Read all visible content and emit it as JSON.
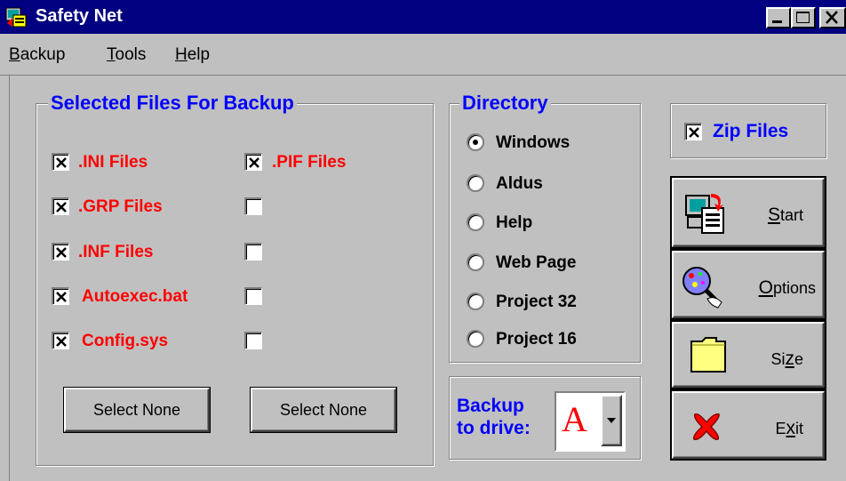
{
  "window": {
    "title": "Safety Net"
  },
  "menu": [
    {
      "label": "Backup",
      "mnemonic": "B",
      "rest": "ackup"
    },
    {
      "label": "Tools",
      "mnemonic": "T",
      "rest": "ools"
    },
    {
      "label": "Help",
      "mnemonic": "H",
      "rest": "elp"
    }
  ],
  "files_group": {
    "title": "Selected Files For Backup",
    "left_column": [
      {
        "label": ".INI Files",
        "checked": true
      },
      {
        "label": ".GRP Files",
        "checked": true
      },
      {
        "label": ".INF Files",
        "checked": true
      },
      {
        "label": "Autoexec.bat",
        "checked": true
      },
      {
        "label": "Config.sys",
        "checked": true
      }
    ],
    "right_column": [
      {
        "label": ".PIF Files",
        "checked": true
      },
      {
        "label": "",
        "checked": false
      },
      {
        "label": "",
        "checked": false
      },
      {
        "label": "",
        "checked": false
      },
      {
        "label": "",
        "checked": false
      }
    ],
    "select_none_left": "Select None",
    "select_none_right": "Select None"
  },
  "directory_group": {
    "title": "Directory",
    "options": [
      "Windows",
      "Aldus",
      "Help",
      "Web Page",
      "Project 32",
      "Project 16"
    ],
    "selected": "Windows"
  },
  "zip": {
    "label": "Zip Files",
    "checked": true
  },
  "actions": {
    "start": {
      "label": "Start",
      "mnemonic": "S",
      "rest": "tart"
    },
    "options": {
      "label": "Options",
      "mnemonic": "O",
      "rest": "ptions"
    },
    "size": {
      "label": "Size",
      "pre": "Si",
      "mnemonic": "z",
      "post": "e"
    },
    "exit": {
      "label": "Exit",
      "pre": "E",
      "mnemonic": "x",
      "post": "it"
    }
  },
  "drive": {
    "label_line1": "Backup",
    "label_line2": "to drive:",
    "value": "A"
  },
  "colors": {
    "title_bar": "#000080",
    "face": "#c0c0c0",
    "legend": "#0000ff",
    "file_label": "#ff0000"
  }
}
